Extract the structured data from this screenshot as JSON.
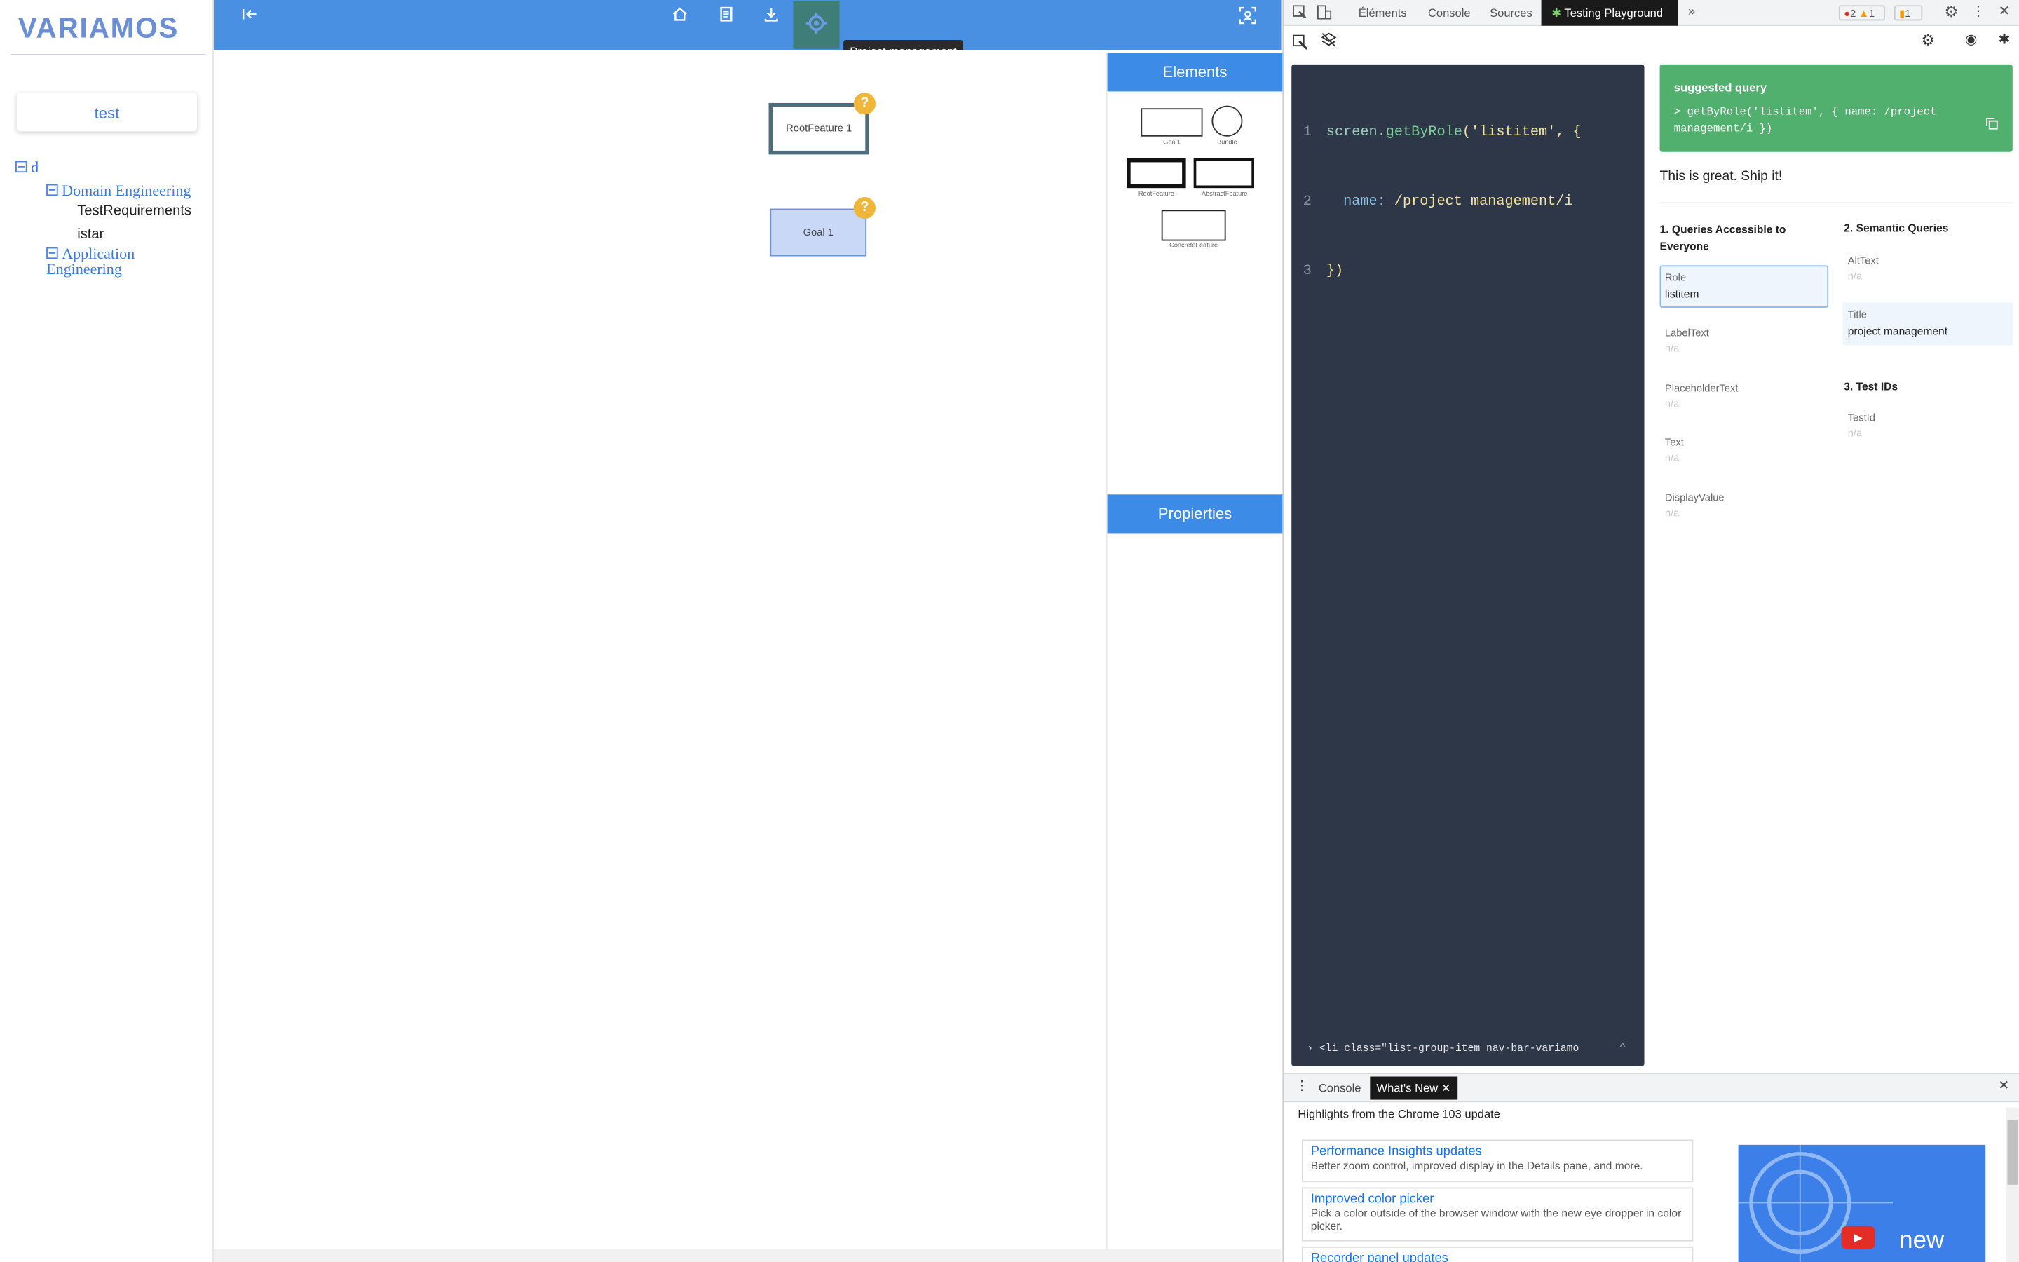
{
  "app": {
    "logo_text": "VARIAMOS",
    "project_name": "test",
    "tree": {
      "root": "d",
      "domain_engineering": "Domain Engineering",
      "domain_children": [
        "TestRequirements",
        "istar"
      ],
      "application_engineering_line1": "Application",
      "application_engineering_line2": "Engineering"
    },
    "toolbar": {
      "icons": [
        "back-icon",
        "home-icon",
        "document-icon",
        "download-icon",
        "gear-icon",
        "fit-screen-icon"
      ],
      "tooltip": "Project management"
    },
    "canvas": {
      "nodes": [
        {
          "label": "RootFeature 1",
          "badge": "?"
        },
        {
          "label": "Goal 1",
          "badge": "?"
        }
      ]
    },
    "palette": {
      "elements_title": "Elements",
      "items": [
        "Goal1",
        "Bundle",
        "RootFeature",
        "AbstractFeature",
        "ConcreteFeature"
      ],
      "properties_title": "Propierties"
    }
  },
  "devtools": {
    "tabs": [
      "Éléments",
      "Console",
      "Sources",
      "Testing Playground"
    ],
    "badges": {
      "errors": "2",
      "warnings": "1",
      "issues": "1"
    },
    "editor": {
      "line_numbers": [
        "1",
        "2",
        "3"
      ],
      "line1_prefix": "screen.",
      "line1_method": "getByRole",
      "line1_args": "('listitem', {",
      "line2_key": "name:",
      "line2_value": " /project management/i",
      "line3": "})",
      "element_preview": "<li class=\"list-group-item nav-bar-variamo"
    },
    "suggested": {
      "title": "suggested query",
      "query": "> getByRole('listitem', { name: /project management/i })",
      "verdict": "This is great. Ship it!"
    },
    "queries": {
      "section1_title": "1. Queries Accessible to Everyone",
      "section2_title": "2. Semantic Queries",
      "section3_title": "3. Test IDs",
      "role_label": "Role",
      "role_value": "listitem",
      "labeltext_label": "LabelText",
      "placeholder_label": "PlaceholderText",
      "text_label": "Text",
      "displayvalue_label": "DisplayValue",
      "alttext_label": "AltText",
      "title_label": "Title",
      "title_value": "project management",
      "testid_label": "TestId",
      "na": "n/a"
    },
    "drawer": {
      "tabs": [
        "Console",
        "What's New"
      ],
      "highlight": "Highlights from the Chrome 103 update",
      "items": [
        {
          "title": "Performance Insights updates",
          "desc": "Better zoom control, improved display in the Details pane, and more."
        },
        {
          "title": "Improved color picker",
          "desc": "Pick a color outside of the browser window with the new eye dropper in color picker."
        },
        {
          "title": "Recorder panel updates",
          "desc": ""
        }
      ],
      "video_text": "new"
    }
  }
}
